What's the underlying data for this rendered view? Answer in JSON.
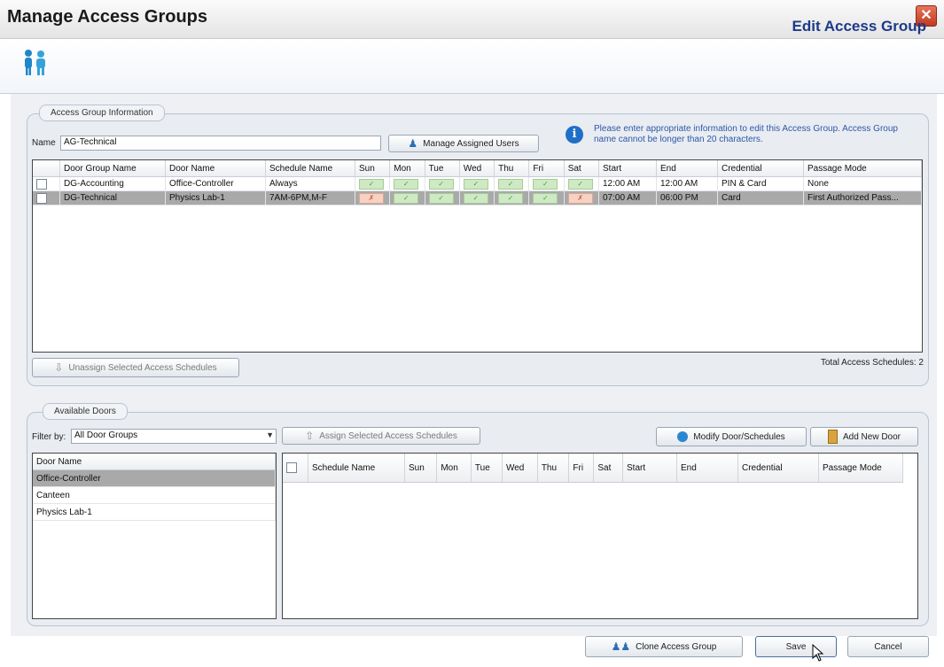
{
  "window": {
    "title": "Manage Access Groups",
    "close_label": "✕"
  },
  "header": {
    "title": "Edit Access Group"
  },
  "info_group": {
    "tab_label": "Access Group Information",
    "name_label": "Name",
    "name_value": "AG-Technical",
    "manage_users_label": "Manage Assigned Users",
    "info_text": "Please enter appropriate information to edit this Access Group. Access Group name cannot be longer than 20 characters.",
    "columns": [
      "Door Group Name",
      "Door Name",
      "Schedule Name",
      "Sun",
      "Mon",
      "Tue",
      "Wed",
      "Thu",
      "Fri",
      "Sat",
      "Start",
      "End",
      "Credential",
      "Passage Mode"
    ],
    "rows": [
      {
        "door_group": "DG-Accounting",
        "door": "Office-Controller",
        "schedule": "Always",
        "days": [
          "y",
          "y",
          "y",
          "y",
          "y",
          "y",
          "y"
        ],
        "start": "12:00 AM",
        "end": "12:00 AM",
        "credential": "PIN & Card",
        "passage": "None",
        "selected": false
      },
      {
        "door_group": "DG-Technical",
        "door": "Physics Lab-1",
        "schedule": "7AM-6PM,M-F",
        "days": [
          "n",
          "y",
          "y",
          "y",
          "y",
          "y",
          "n"
        ],
        "start": "07:00 AM",
        "end": "06:00 PM",
        "credential": "Card",
        "passage": "First Authorized Pass...",
        "selected": true
      }
    ],
    "unassign_label": "Unassign Selected Access Schedules",
    "total_label": "Total Access Schedules: 2"
  },
  "doors_group": {
    "tab_label": "Available Doors",
    "filter_label": "Filter by:",
    "filter_value": "All Door Groups",
    "assign_label": "Assign Selected Access Schedules",
    "modify_label": "Modify Door/Schedules",
    "add_door_label": "Add New Door",
    "door_list_header": "Door Name",
    "doors": [
      "Office-Controller",
      "Canteen",
      "Physics Lab-1"
    ],
    "schedule_columns": [
      "Schedule Name",
      "Sun",
      "Mon",
      "Tue",
      "Wed",
      "Thu",
      "Fri",
      "Sat",
      "Start",
      "End",
      "Credential",
      "Passage Mode"
    ]
  },
  "footer": {
    "clone_label": "Clone Access Group",
    "save_label": "Save",
    "cancel_label": "Cancel"
  },
  "colors": {
    "header_title": "#1d3a8a",
    "selected_row": "#a9a9a9",
    "day_allowed": "#cfe9c4",
    "day_denied": "#f6d2c4"
  }
}
